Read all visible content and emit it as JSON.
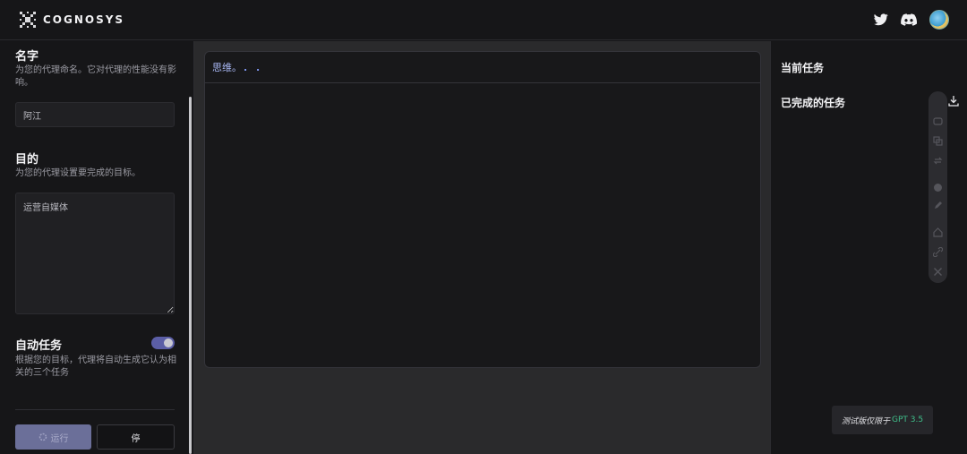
{
  "header": {
    "brand": "COGNOSYS",
    "icons": [
      "twitter-icon",
      "discord-icon",
      "avatar"
    ]
  },
  "agent_form": {
    "name_title": "名字",
    "name_desc": "为您的代理命名。它对代理的性能没有影响。",
    "name_value": "阿江",
    "goal_title": "目的",
    "goal_desc": "为您的代理设置要完成的目标。",
    "goal_value": "运营自媒体",
    "auto_title": "自动任务",
    "auto_desc": "根据您的目标，代理将自动生成它认为相关的三个任务",
    "auto_enabled": true,
    "run_label": "运行",
    "stop_label": "停"
  },
  "output_panel": {
    "thinking_label": "思维。",
    "thinking_dots": ". ."
  },
  "tasks": {
    "current_title": "当前任务",
    "completed_title": "已完成的任务"
  },
  "toast": {
    "text": "测试版仅限于",
    "model": "GPT 3.5"
  },
  "colors": {
    "accent": "#5b5ea6",
    "link": "#a7b6f2",
    "gpt": "#3fbf8a"
  }
}
